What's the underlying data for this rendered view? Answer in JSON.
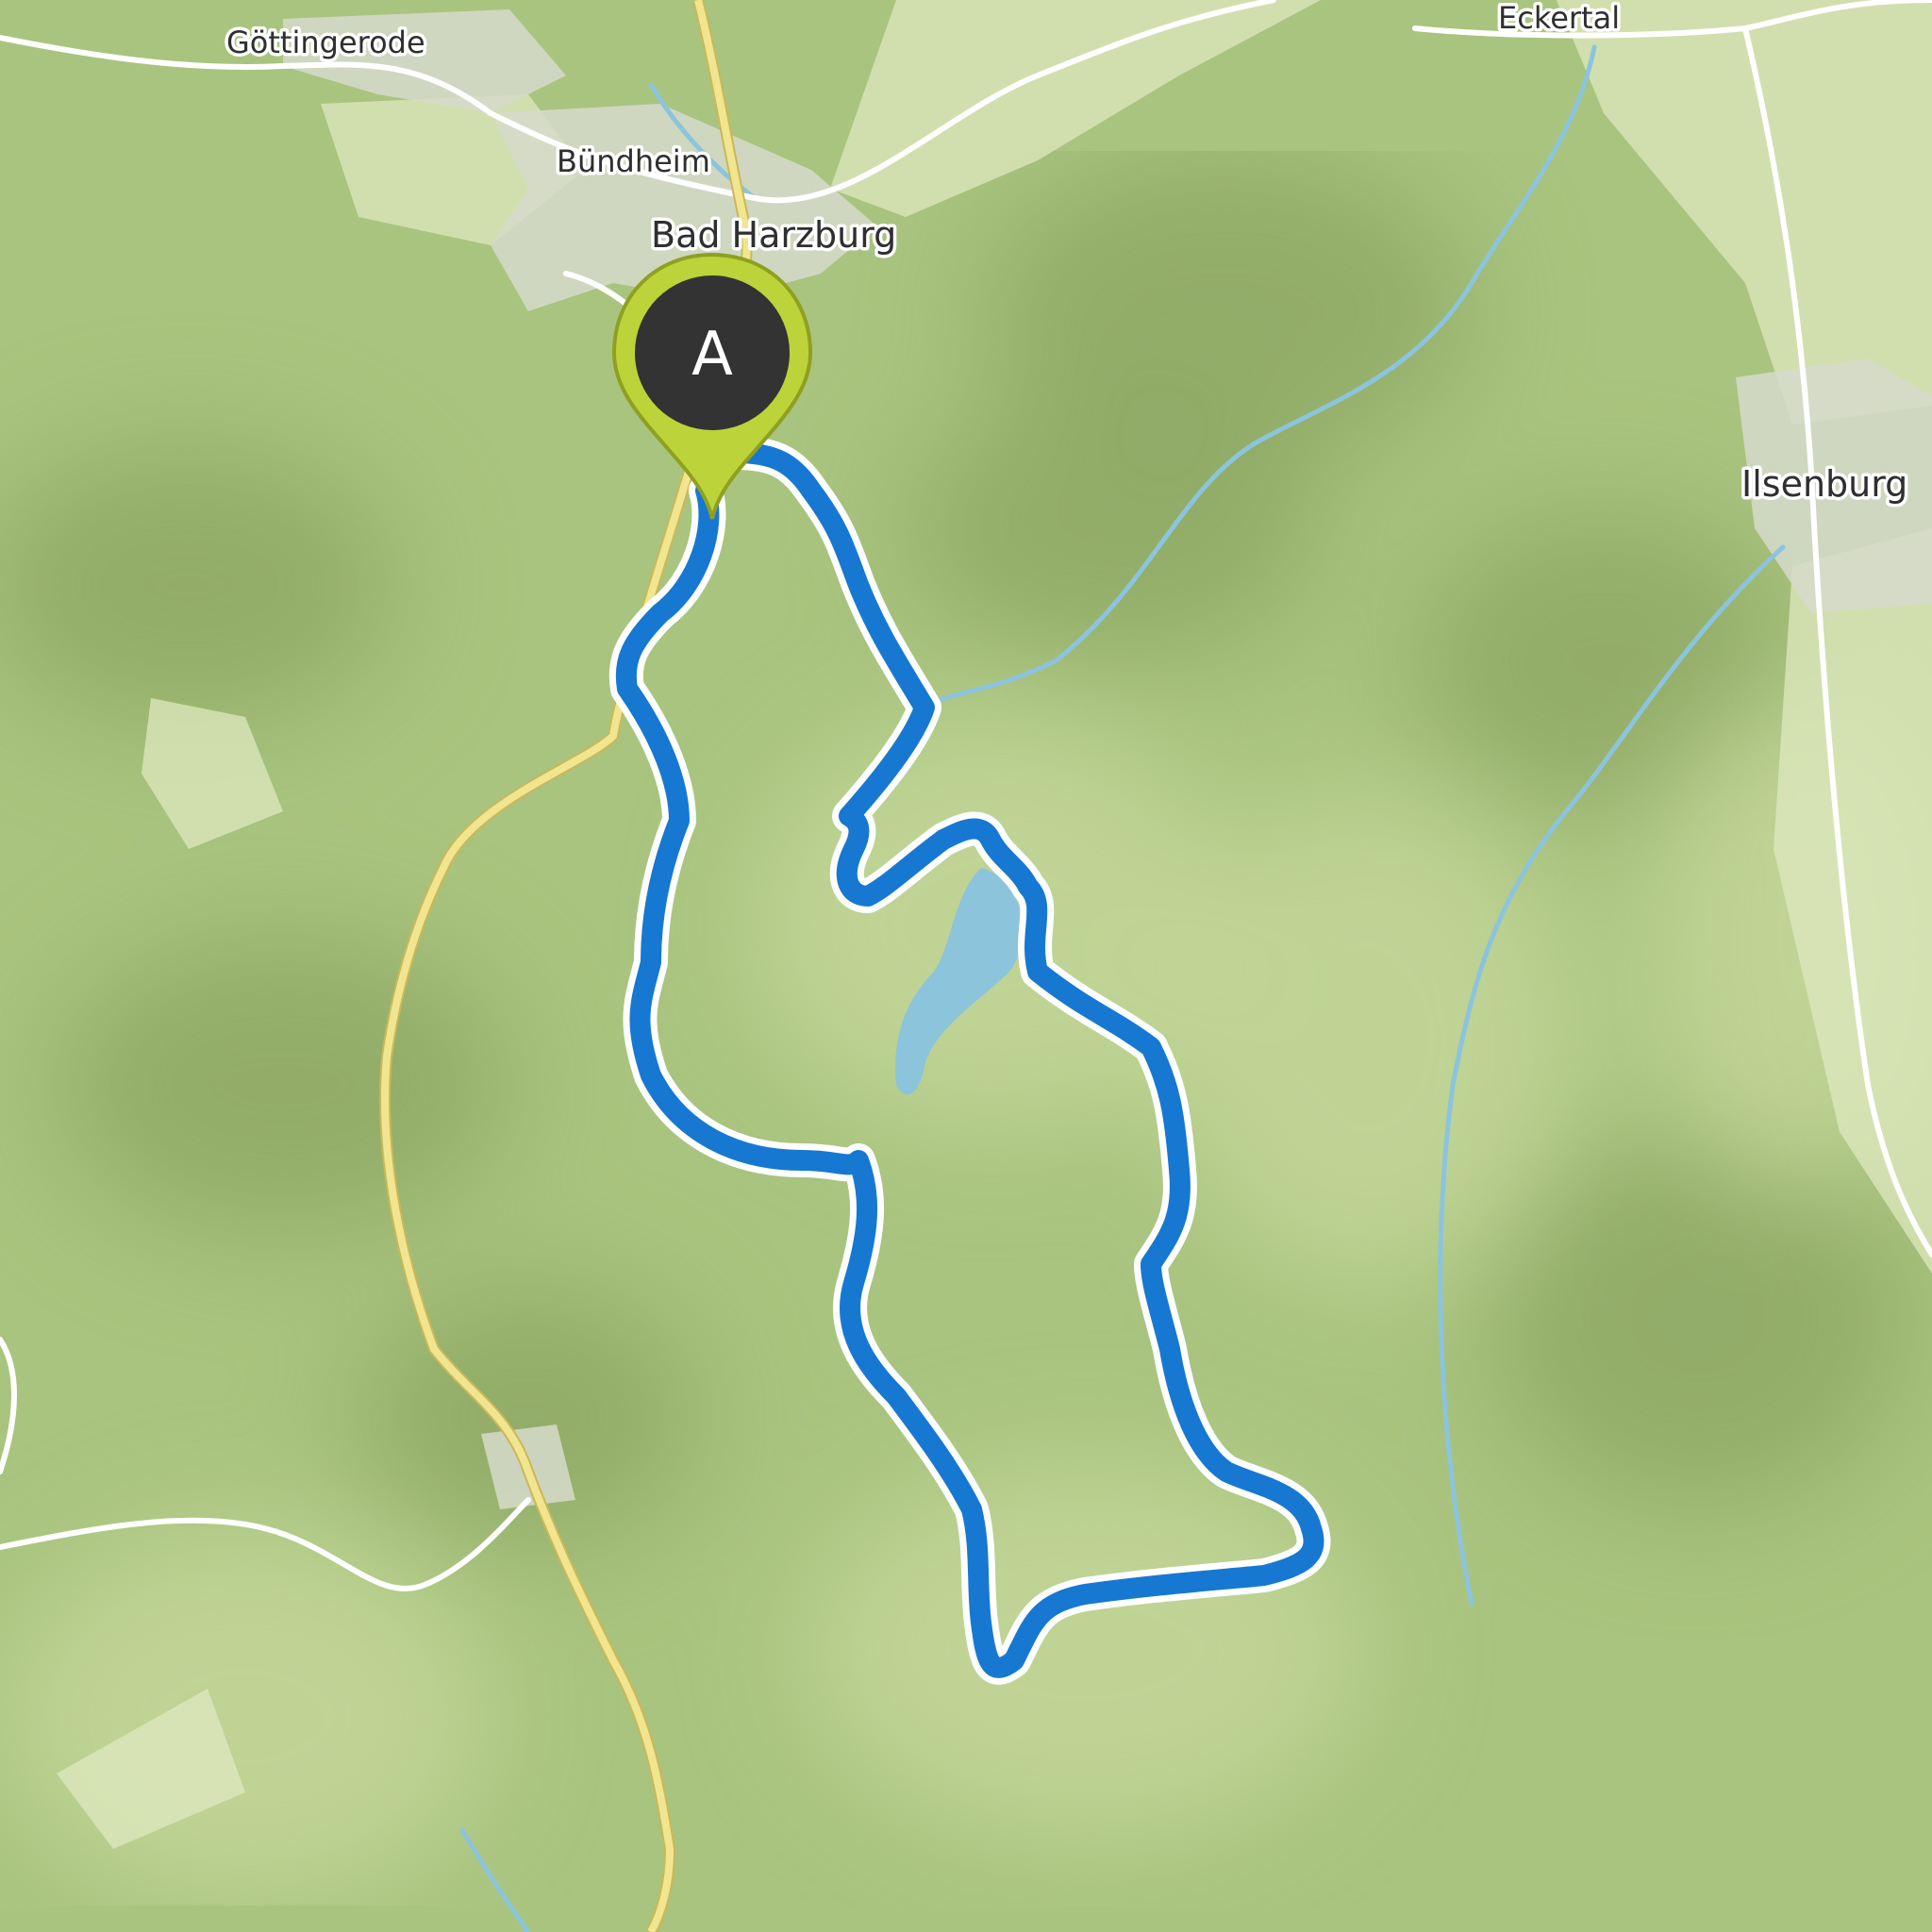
{
  "map": {
    "type": "topographic-route-map",
    "colors": {
      "terrain_base": "#a9c47f",
      "terrain_light": "#c4d79a",
      "terrain_dark": "#8ea965",
      "settlement": "#d6dacb",
      "open_field": "#dfe8bf",
      "water": "#8cc4dc",
      "road_primary": "#f1e58f",
      "road_minor": "#ffffff",
      "route_line": "#1778d2",
      "route_casing": "#ffffff",
      "marker_fill": "#bcd33a",
      "marker_inner": "#333333"
    },
    "places": [
      {
        "id": "gottingerode",
        "name": "Göttingerode",
        "class": "village"
      },
      {
        "id": "bundheim",
        "name": "Bündheim",
        "class": "village"
      },
      {
        "id": "bad-harzburg",
        "name": "Bad Harzburg",
        "class": "town"
      },
      {
        "id": "eckertal",
        "name": "Eckertal",
        "class": "village"
      },
      {
        "id": "ilsenburg",
        "name": "Ilsenburg",
        "class": "town"
      }
    ],
    "start_marker": {
      "letter": "A",
      "icon": "map-pin-icon"
    },
    "route": {
      "type": "loop",
      "icon": "route-line"
    }
  }
}
